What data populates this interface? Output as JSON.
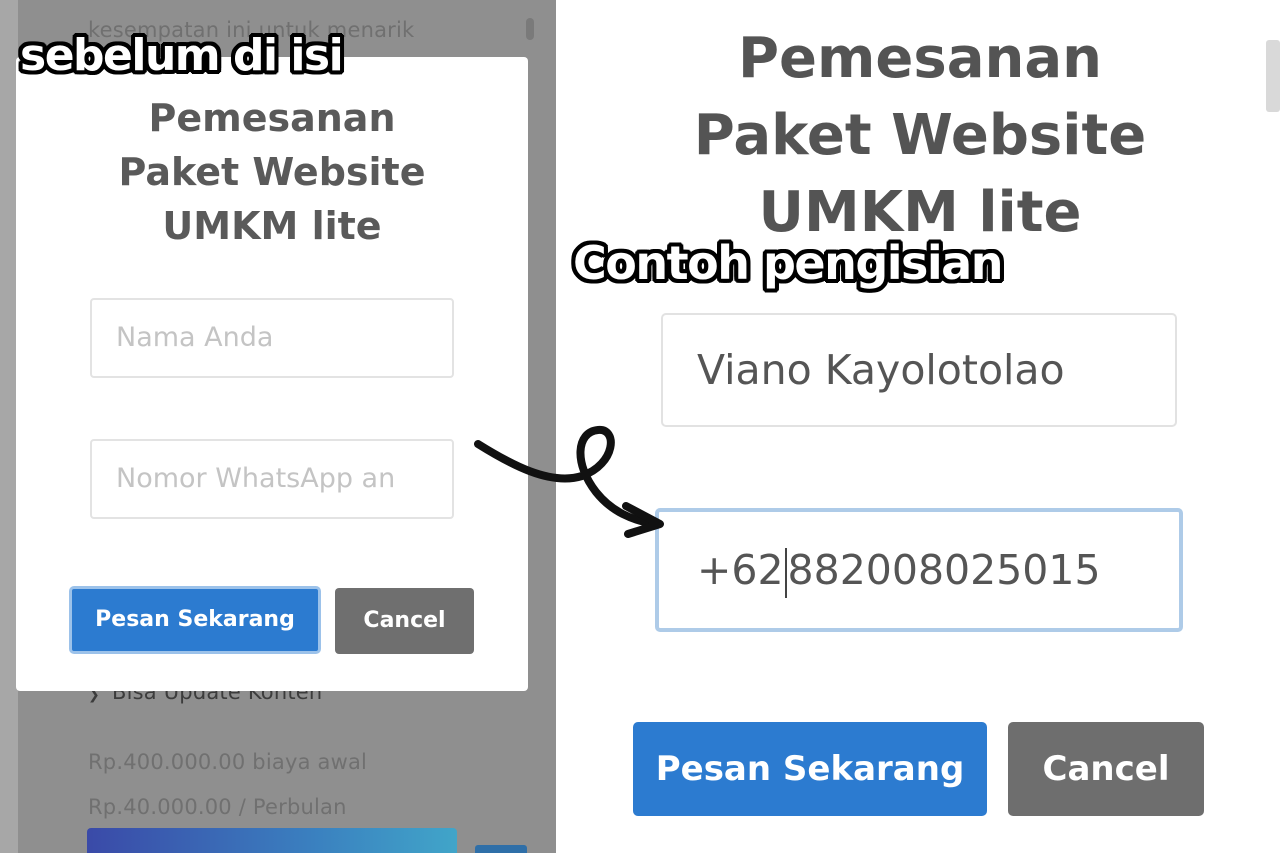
{
  "background_page": {
    "top_text": "kesempatan ini untuk menarik",
    "feature_item": "Bisa Update Konten",
    "price_initial": "Rp.400.000.00 biaya awal",
    "price_monthly": "Rp.40.000.00 / Perbulan"
  },
  "captions": {
    "before": "sebelum di isi",
    "example": "Contoh pengisian"
  },
  "modal_before": {
    "title_lines": [
      "Pemesanan",
      "Paket Website",
      "UMKM lite"
    ],
    "name_placeholder": "Nama Anda",
    "whatsapp_placeholder": "Nomor WhatsApp an",
    "submit_label": "Pesan Sekarang",
    "cancel_label": "Cancel"
  },
  "modal_example": {
    "title_lines": [
      "Pemesanan",
      "Paket Website",
      "UMKM lite"
    ],
    "name_value": "Viano Kayolotolao",
    "whatsapp_value_before_caret": "+62",
    "whatsapp_value_after_caret": "882008025015",
    "submit_label": "Pesan Sekarang",
    "cancel_label": "Cancel"
  },
  "colors": {
    "primary_button": "#2c7bd0",
    "cancel_button": "#6f6f6f",
    "overlay": "#8f8f8f",
    "title_text": "#5a5a5a"
  },
  "icons": {
    "feature_chevron": "chevron-down-icon",
    "annotation_arrow": "curved-arrow-icon"
  }
}
